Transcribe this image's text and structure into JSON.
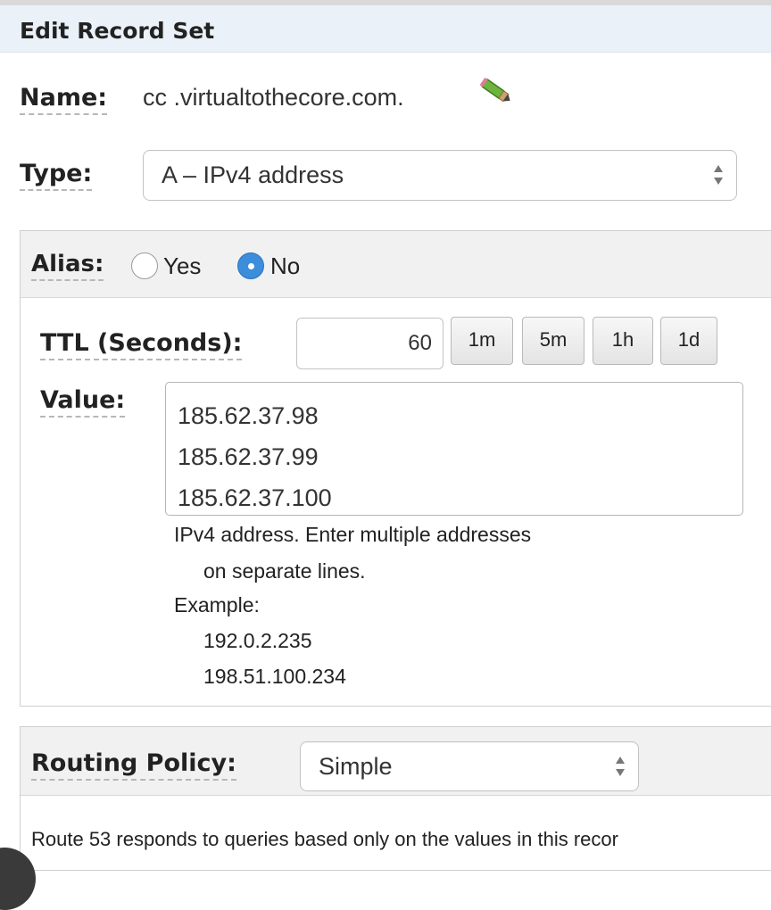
{
  "header": {
    "title": "Edit Record Set"
  },
  "name": {
    "label": "Name:",
    "value": "cc .virtualtothecore.com.",
    "edit_icon": "pencil-icon"
  },
  "type": {
    "label": "Type:",
    "selected": "A – IPv4 address"
  },
  "alias": {
    "label": "Alias:",
    "yes_label": "Yes",
    "no_label": "No",
    "selected": "No"
  },
  "ttl": {
    "label": "TTL (Seconds):",
    "value": "60",
    "buttons": [
      "1m",
      "5m",
      "1h",
      "1d"
    ]
  },
  "value": {
    "label": "Value:",
    "lines": [
      "185.62.37.98",
      "185.62.37.99",
      "185.62.37.100"
    ],
    "help_line1": "IPv4 address. Enter multiple addresses",
    "help_line2": "on separate lines.",
    "example_label": "Example:",
    "examples": [
      "192.0.2.235",
      "198.51.100.234"
    ]
  },
  "routing": {
    "label": "Routing Policy:",
    "selected": "Simple",
    "description": "Route 53 responds to queries based only on the values in this recor"
  },
  "colors": {
    "accent": "#3c8ddc",
    "header_bg": "#eaf1f8",
    "panel_bg": "#f1f1f1"
  }
}
